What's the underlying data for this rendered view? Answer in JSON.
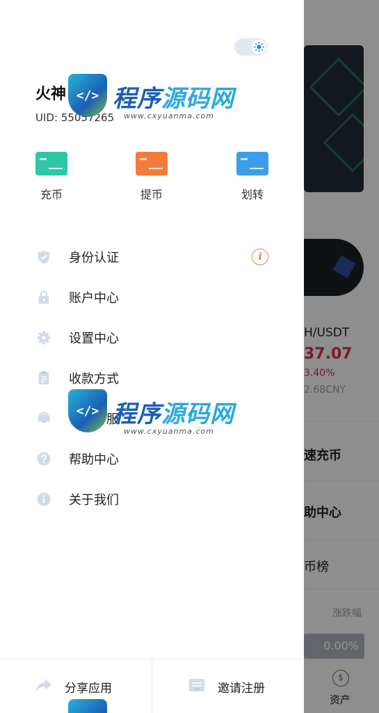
{
  "background": {
    "pair": "H/USDT",
    "price": "37.07",
    "change": "3.40%",
    "cny": "2.68CNY",
    "quick_deposit": "速充币",
    "help_center": "助中心",
    "ranking": "币榜",
    "change_header": "涨跌幅",
    "change_badge": "0.00%",
    "tab_asset": "资产",
    "asset_icon_symbol": "$"
  },
  "drawer": {
    "username": "火神",
    "uid": "UID: 55057265",
    "actions": [
      {
        "label": "充币",
        "color": "#2fc6a6",
        "icon": "deposit-card-icon"
      },
      {
        "label": "提币",
        "color": "#f47a3a",
        "icon": "withdraw-card-icon"
      },
      {
        "label": "划转",
        "color": "#3a9eea",
        "icon": "transfer-card-icon"
      }
    ],
    "menu": [
      {
        "label": "身份认证",
        "icon": "shield-check-icon"
      },
      {
        "label": "账户中心",
        "icon": "lock-icon"
      },
      {
        "label": "设置中心",
        "icon": "gear-icon"
      },
      {
        "label": "收款方式",
        "icon": "clipboard-icon"
      },
      {
        "label": "在线客服",
        "icon": "headset-icon"
      },
      {
        "label": "帮助中心",
        "icon": "question-icon"
      },
      {
        "label": "关于我们",
        "icon": "info-icon"
      }
    ],
    "warning_symbol": "i",
    "footer": {
      "share": "分享应用",
      "invite": "邀请注册"
    }
  },
  "watermark": {
    "title_a": "程序",
    "title_b": "源码网",
    "url": "www.cxyuanma.com",
    "shield_text": "</>"
  },
  "colors": {
    "icon_gray": "#d3dbe6",
    "accent_warn": "#ec7a4a",
    "price_red": "#d0304f"
  }
}
